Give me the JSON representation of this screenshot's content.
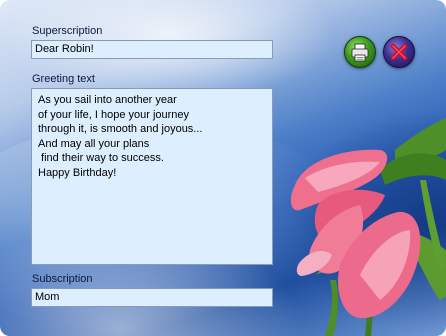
{
  "form": {
    "superscription_label": "Superscription",
    "superscription_value": "Dear Robin!",
    "greeting_label": "Greeting text",
    "greeting_lines": [
      "As you sail into another year",
      "of your life, I hope your journey",
      "through it, is smooth and joyous...",
      "And may all your plans",
      " find their way to success.",
      "Happy Birthday!"
    ],
    "subscription_label": "Subscription",
    "subscription_value": "Mom"
  },
  "toolbar": {
    "print_icon": "printer-icon",
    "close_icon": "close-icon"
  },
  "colors": {
    "field_background": "#ddeeff",
    "print_button": "#3d9b1e",
    "close_button": "#3b2f8f",
    "close_x": "#c8102e"
  }
}
